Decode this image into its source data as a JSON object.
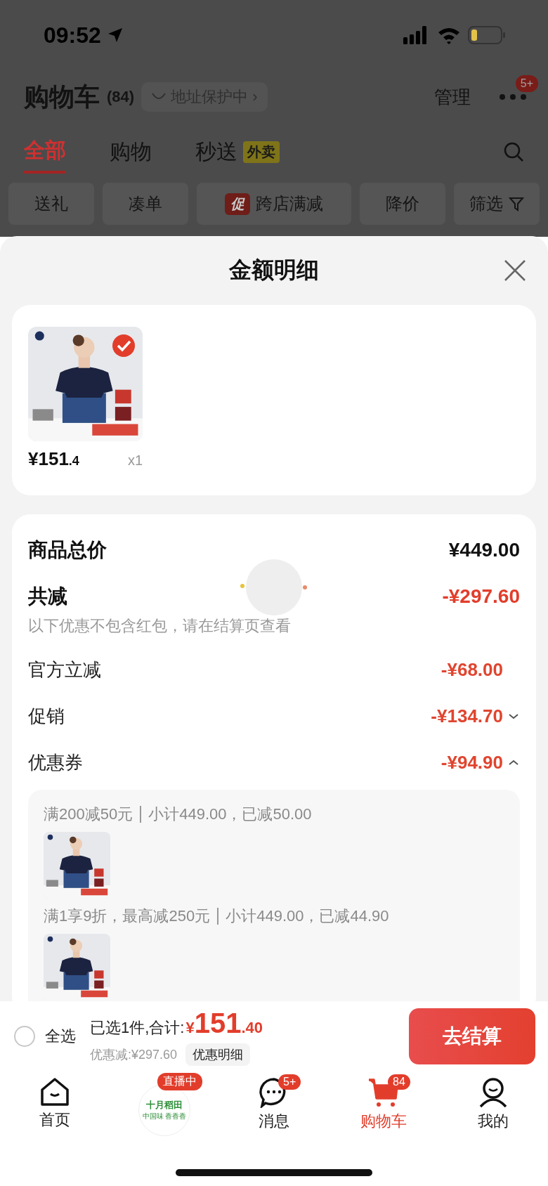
{
  "status_bar": {
    "time": "09:52"
  },
  "header": {
    "title": "购物车",
    "count": "(84)",
    "address": "地址保护中",
    "address_arrow": "›",
    "manage": "管理",
    "more_badge": "5+"
  },
  "tabs": [
    {
      "label": "全部",
      "selected": true
    },
    {
      "label": "购物",
      "selected": false
    },
    {
      "label": "秒送",
      "badge": "外卖",
      "selected": false
    }
  ],
  "filters": [
    {
      "label": "送礼",
      "kind": "plain"
    },
    {
      "label": "凑单",
      "kind": "plain"
    },
    {
      "label": "跨店满减",
      "kind": "promo",
      "tag": "促"
    },
    {
      "label": "降价",
      "kind": "plain"
    },
    {
      "label": "筛选",
      "kind": "filter"
    }
  ],
  "sheet": {
    "title": "金额明细",
    "items": [
      {
        "kind": "picture",
        "checked": true,
        "price": "¥151",
        "price_decimal": ".4",
        "quantity": "x1"
      }
    ],
    "total": {
      "label": "商品总价",
      "value": "¥449.00"
    },
    "reduction": {
      "label": "共减",
      "value": "-¥297.60",
      "note": "以下优惠不包含红包，请在结算页查看"
    },
    "lines": [
      {
        "label": "官方立减",
        "value": "-¥68.00",
        "kind": "plain"
      },
      {
        "label": "促销",
        "value": "-¥134.70",
        "kind": "toggle",
        "expanded": false
      },
      {
        "label": "优惠券",
        "value": "-¥94.90",
        "kind": "toggle",
        "expanded": true
      }
    ],
    "coupons": [
      {
        "rule": "满200减50元",
        "detail": "小计449.00，已减50.00",
        "kind": "picture"
      },
      {
        "rule": "满1享9折，最高减250元",
        "detail": "小计449.00，已减44.90",
        "kind": "picture"
      }
    ]
  },
  "checkout": {
    "select_all": "全选",
    "all_selected": false,
    "selected_text": "已选1件,合计:",
    "currency": "¥",
    "amount": "151",
    "amount_decimal": ".40",
    "discount": "优惠减:¥297.60",
    "detail_button": "优惠明细",
    "checkout_button": "去结算"
  },
  "nav": [
    {
      "kind": "home",
      "label": "首页",
      "selected": false
    },
    {
      "kind": "live",
      "badge": "直播中",
      "logo_title": "十月稻田",
      "logo_slogan": "中国味 香香香"
    },
    {
      "kind": "messages",
      "label": "消息",
      "badge": "5+",
      "selected": false
    },
    {
      "kind": "cart",
      "label": "购物车",
      "badge": "84",
      "selected": true
    },
    {
      "kind": "me",
      "label": "我的",
      "selected": false
    }
  ]
}
